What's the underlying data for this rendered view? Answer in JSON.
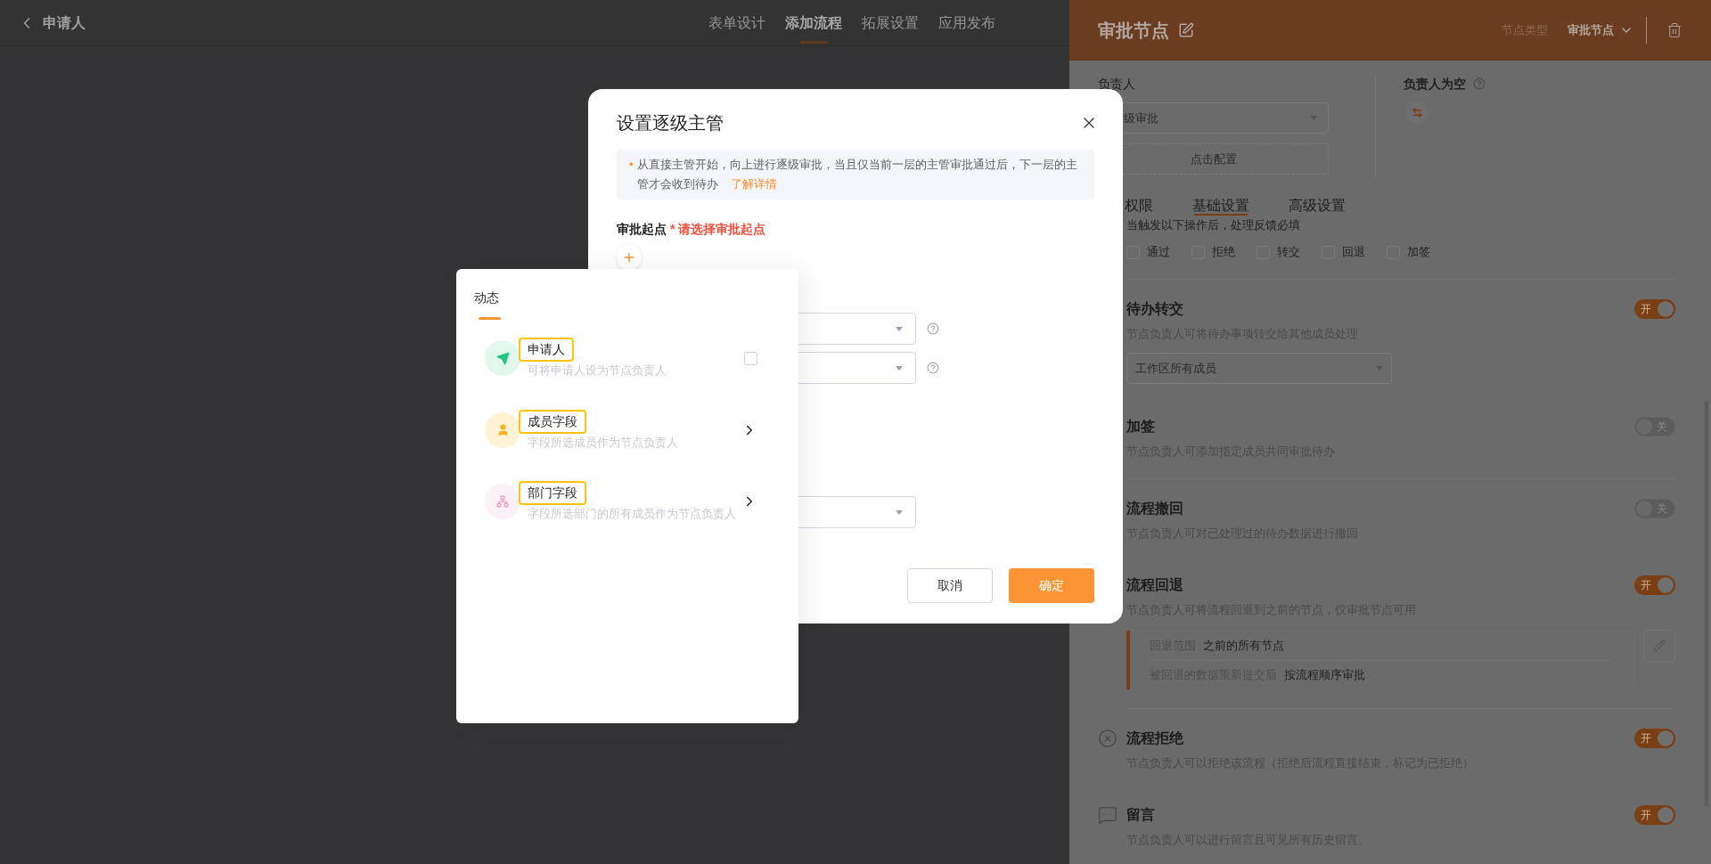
{
  "topbar": {
    "title": "申请人",
    "tabs": [
      {
        "label": "表单设计",
        "selected": false
      },
      {
        "label": "添加流程",
        "selected": true
      },
      {
        "label": "拓展设置",
        "selected": false
      },
      {
        "label": "应用发布",
        "selected": false
      }
    ]
  },
  "panel": {
    "title": "审批节点",
    "type_label": "节点类型",
    "type_value": "审批节点",
    "assignee": {
      "label": "负责人",
      "select_value": "级审批",
      "config_button": "点击配置"
    },
    "empty": {
      "label": "负责人为空"
    },
    "tabs": [
      {
        "label": "权限",
        "selected": false
      },
      {
        "label": "基础设置",
        "selected": true
      },
      {
        "label": "高级设置",
        "selected": false
      }
    ],
    "feedback": {
      "label": "当触发以下操作后，处理反馈必填",
      "options": [
        {
          "label": "通过",
          "checked": false
        },
        {
          "label": "拒绝",
          "checked": false
        },
        {
          "label": "转交",
          "checked": false
        },
        {
          "label": "回退",
          "checked": false
        },
        {
          "label": "加签",
          "checked": false
        }
      ]
    },
    "groups": [
      [
        {
          "title": "待办转交",
          "description": "节点负责人可将待办事项转交给其他成员处理",
          "on": true,
          "on_label": "开",
          "select_value": "工作区所有成员"
        },
        {
          "title": "加签",
          "description": "节点负责人可添加指定成员共同审批待办",
          "on": false,
          "off_label": "关"
        }
      ],
      [
        {
          "title": "流程撤回",
          "description": "节点负责人可对已处理过的待办数据进行撤回",
          "on": false,
          "off_label": "关"
        },
        {
          "title": "流程回退",
          "description": "节点负责人可将流程回退到之前的节点，仅审批节点可用",
          "on": true,
          "on_label": "开",
          "details": [
            {
              "label": "回退范围",
              "value": "之前的所有节点"
            },
            {
              "label": "被回退的数据重新提交后",
              "value": "按流程顺序审批"
            }
          ]
        }
      ],
      [
        {
          "title": "流程拒绝",
          "description": "节点负责人可以拒绝该流程（拒绝后流程直接结束，标记为已拒绝）",
          "on": true,
          "on_label": "开"
        },
        {
          "title": "留言",
          "description": "节点负责人可以进行留言且可见所有历史留言。",
          "on": true,
          "on_label": "开"
        }
      ]
    ]
  },
  "modal": {
    "title": "设置逐级主管",
    "notice_bullet": "•",
    "notice": "从直接主管开始，向上进行逐级审批，当且仅当前一层的主管审批通过后，下一层的主管才会收到待办",
    "notice_link": "了解详情",
    "start_label": "审批起点",
    "required_mark": "*",
    "start_error": "请选择审批起点",
    "fields": [
      {
        "help": true
      },
      {
        "help": true
      },
      {
        "help": false
      }
    ],
    "cancel": "取消",
    "ok": "确定"
  },
  "popup": {
    "tab": "动态",
    "items": [
      {
        "title": "申请人",
        "description": "可将申请人设为节点负责人",
        "kind": "checkbox",
        "checked": false
      },
      {
        "title": "成员字段",
        "description": "字段所选成员作为节点负责人",
        "kind": "submenu"
      },
      {
        "title": "部门字段",
        "description": "字段所选部门的所有成员作为节点负责人",
        "kind": "submenu"
      }
    ]
  }
}
